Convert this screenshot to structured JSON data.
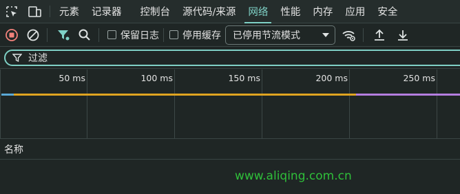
{
  "tabbar": {
    "inspect_icon": "inspect-cursor-icon",
    "device_icon": "device-toggle-icon",
    "tabs": [
      {
        "label": "元素",
        "active": false
      },
      {
        "label": "记录器",
        "active": false
      },
      {
        "label": "控制台",
        "active": false
      },
      {
        "label": "源代码/来源",
        "active": false
      },
      {
        "label": "网络",
        "active": true
      },
      {
        "label": "性能",
        "active": false
      },
      {
        "label": "内存",
        "active": false
      },
      {
        "label": "应用",
        "active": false
      },
      {
        "label": "安全",
        "active": false
      }
    ]
  },
  "toolbar": {
    "preserve_log_label": "保留日志",
    "disable_cache_label": "停用缓存",
    "throttling_value": "已停用节流模式",
    "record_color": "#f2827b",
    "accent_color": "#7fd1c6"
  },
  "filter": {
    "placeholder": "过滤"
  },
  "timeline": {
    "ticks": [
      "50 ms",
      "100 ms",
      "150 ms",
      "200 ms",
      "250 ms"
    ]
  },
  "list": {
    "name_header": "名称"
  },
  "watermark": "www.aliqing.com.cn"
}
